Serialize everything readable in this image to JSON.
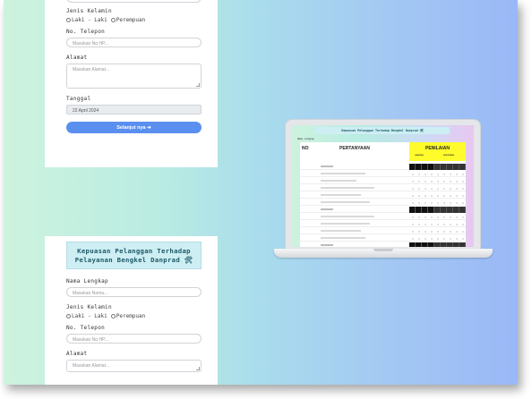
{
  "form": {
    "gender_label": "Jenis Kelamin",
    "gender_options": [
      "Laki - Laki",
      "Perempuan"
    ],
    "phone_label": "No. Telepon",
    "phone_placeholder": "Masukan No.HP...",
    "address_label": "Alamat",
    "address_placeholder": "Masukan Alamat...",
    "date_label": "Tanggal",
    "date_value": "22 April 2024",
    "next_button": "Selanjut nya ➔",
    "title_line1": "Kepuasan Pelanggan Terhadap",
    "title_line2": "Pelayanan Bengkel Danprad 🛠",
    "name_label": "Nama Lengkap",
    "name_placeholder": "Masukan Nama..."
  },
  "laptop_screen": {
    "title": "Kepuasan Pelanggan Terhadap Bengkel Danprad 🛠",
    "header_no": "NO",
    "header_question": "PERTANYAAN",
    "header_rating": "PENILAIAN",
    "sub_left": "HARAPAN",
    "sub_right": "KENYATAAN"
  },
  "colors": {
    "button": "#5a8ff0",
    "title_bg": "#cdeef3",
    "rating_header": "#fffb2d"
  }
}
